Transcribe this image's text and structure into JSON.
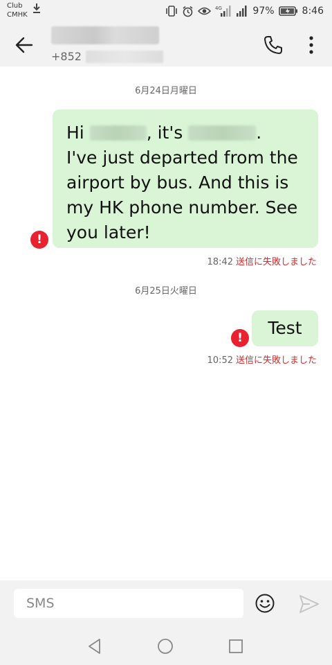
{
  "status_bar": {
    "carrier_line1": "Club",
    "carrier_line2": "CMHK",
    "battery_percent": "97%",
    "time": "8:46",
    "icons": [
      "download-icon",
      "vibrate-icon",
      "alarm-icon",
      "eye-icon",
      "signal-4g-icon",
      "signal-icon",
      "battery-icon"
    ]
  },
  "header": {
    "contact_number_prefix": "+852",
    "icons": [
      "back-arrow-icon",
      "phone-icon",
      "more-vert-icon"
    ]
  },
  "messages": [
    {
      "date": "6月24日月曜日",
      "text_part1": "Hi",
      "text_part2": ", it's",
      "text_part3": ".",
      "text_rest": "I've just departed from the airport by bus. And this is my HK phone number. See you later!",
      "time": "18:42",
      "status": "送信に失敗しました",
      "error_symbol": "!"
    },
    {
      "date": "6月25日火曜日",
      "text": "Test",
      "time": "10:52",
      "status": "送信に失敗しました",
      "error_symbol": "!"
    }
  ],
  "composer": {
    "placeholder": "SMS",
    "icons": [
      "emoji-icon",
      "send-icon"
    ]
  },
  "navbar": {
    "icons": [
      "nav-back-icon",
      "nav-home-icon",
      "nav-recent-icon"
    ]
  },
  "colors": {
    "bubble": "#d9f5d6",
    "error": "#e8222e",
    "fail_text": "#d42b2b",
    "bar_bg": "#f2f2f2"
  }
}
